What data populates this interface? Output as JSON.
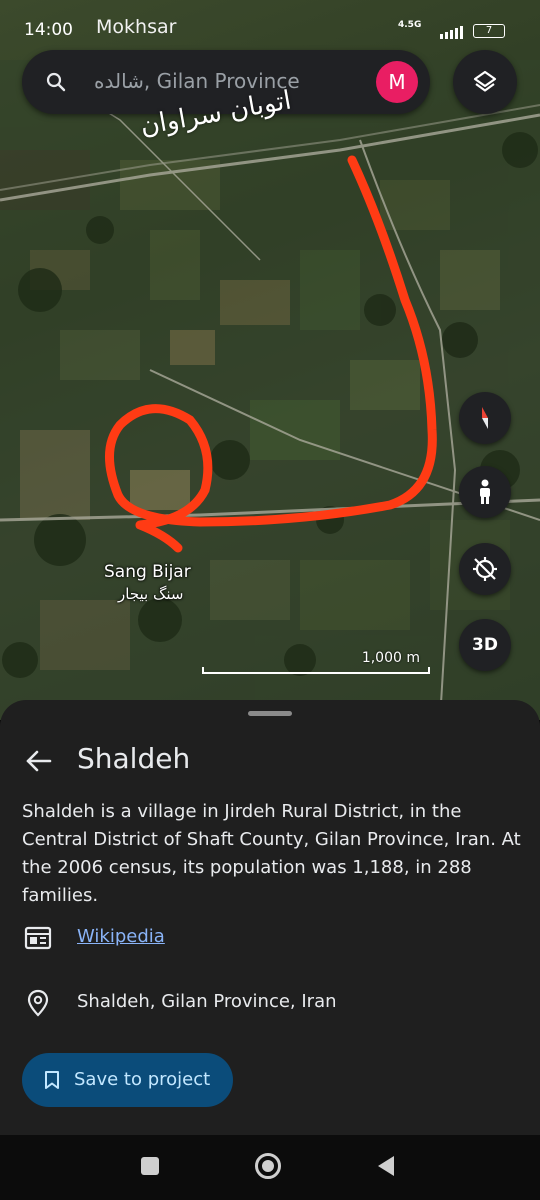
{
  "status_bar": {
    "time": "14:00",
    "carrier": "Mokhsar",
    "network": "4.5G",
    "battery": "7"
  },
  "search": {
    "query": "شالده, Gilan Province",
    "avatar_initial": "M",
    "avatar_color": "#e91e63"
  },
  "map": {
    "road_label": "اتوبان سراوان",
    "place_name_en": "Sang Bijar",
    "place_name_fa": "سنگ بیجار",
    "scale_label": "1,000 m",
    "annotation_color": "#ff3b14",
    "controls": {
      "compass_icon": "compass-icon",
      "street_view_icon": "pegman-icon",
      "location_icon": "location-off-icon",
      "three_d_label": "3D"
    }
  },
  "place": {
    "title": "Shaldeh",
    "description": "Shaldeh is a village in Jirdeh Rural District, in the Central District of Shaft County, Gilan Province, Iran. At the 2006 census, its population was 1,188, in 288 families.",
    "source_link": "Wikipedia",
    "address": "Shaldeh, Gilan Province, Iran",
    "save_button": "Save to project"
  },
  "nav": {
    "recents_icon": "square-icon",
    "home_icon": "circle-icon",
    "back_icon": "triangle-back-icon"
  }
}
